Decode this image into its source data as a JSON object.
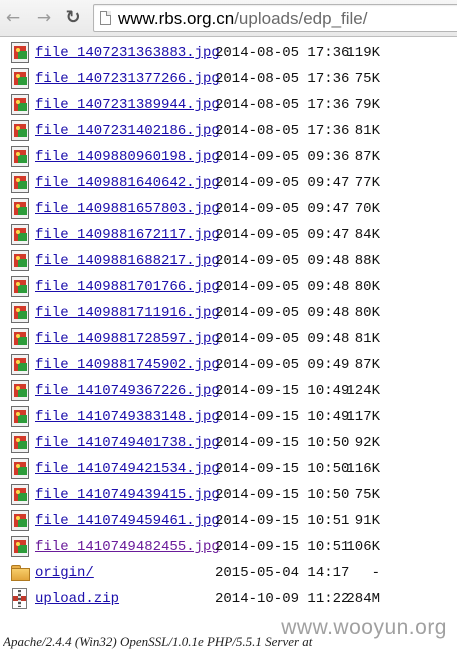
{
  "browser": {
    "url_host": "www.rbs.org.cn",
    "url_path": "/uploads/edp_file/"
  },
  "listing": {
    "entries": [
      {
        "type": "image",
        "name": "file_1407231363883.jpg",
        "date": "2014-08-05 17:36",
        "size": "119K"
      },
      {
        "type": "image",
        "name": "file_1407231377266.jpg",
        "date": "2014-08-05 17:36",
        "size": "75K"
      },
      {
        "type": "image",
        "name": "file_1407231389944.jpg",
        "date": "2014-08-05 17:36",
        "size": "79K"
      },
      {
        "type": "image",
        "name": "file_1407231402186.jpg",
        "date": "2014-08-05 17:36",
        "size": "81K"
      },
      {
        "type": "image",
        "name": "file_1409880960198.jpg",
        "date": "2014-09-05 09:36",
        "size": "87K"
      },
      {
        "type": "image",
        "name": "file_1409881640642.jpg",
        "date": "2014-09-05 09:47",
        "size": "77K"
      },
      {
        "type": "image",
        "name": "file_1409881657803.jpg",
        "date": "2014-09-05 09:47",
        "size": "70K"
      },
      {
        "type": "image",
        "name": "file_1409881672117.jpg",
        "date": "2014-09-05 09:47",
        "size": "84K"
      },
      {
        "type": "image",
        "name": "file_1409881688217.jpg",
        "date": "2014-09-05 09:48",
        "size": "88K"
      },
      {
        "type": "image",
        "name": "file_1409881701766.jpg",
        "date": "2014-09-05 09:48",
        "size": "80K"
      },
      {
        "type": "image",
        "name": "file_1409881711916.jpg",
        "date": "2014-09-05 09:48",
        "size": "80K"
      },
      {
        "type": "image",
        "name": "file_1409881728597.jpg",
        "date": "2014-09-05 09:48",
        "size": "81K"
      },
      {
        "type": "image",
        "name": "file_1409881745902.jpg",
        "date": "2014-09-05 09:49",
        "size": "87K"
      },
      {
        "type": "image",
        "name": "file_1410749367226.jpg",
        "date": "2014-09-15 10:49",
        "size": "124K"
      },
      {
        "type": "image",
        "name": "file_1410749383148.jpg",
        "date": "2014-09-15 10:49",
        "size": "117K"
      },
      {
        "type": "image",
        "name": "file_1410749401738.jpg",
        "date": "2014-09-15 10:50",
        "size": "92K"
      },
      {
        "type": "image",
        "name": "file_1410749421534.jpg",
        "date": "2014-09-15 10:50",
        "size": "116K"
      },
      {
        "type": "image",
        "name": "file_1410749439415.jpg",
        "date": "2014-09-15 10:50",
        "size": "75K"
      },
      {
        "type": "image",
        "name": "file_1410749459461.jpg",
        "date": "2014-09-15 10:51",
        "size": "91K"
      },
      {
        "type": "image",
        "name": "file_1410749482455.jpg",
        "date": "2014-09-15 10:51",
        "size": "106K",
        "visited": true
      },
      {
        "type": "folder",
        "name": "origin/",
        "date": "2015-05-04 14:17",
        "size": "-"
      },
      {
        "type": "zip",
        "name": "upload.zip",
        "date": "2014-10-09 11:22",
        "size": "284M"
      }
    ]
  },
  "footer": {
    "server_signature": "Apache/2.4.4 (Win32) OpenSSL/1.0.1e PHP/5.5.1 Server at"
  },
  "watermark": {
    "text": "www.wooyun.org"
  },
  "icons": {
    "back": "back-arrow-icon",
    "forward": "forward-arrow-icon",
    "reload": "reload-icon",
    "page": "page-icon",
    "image": "image-file-icon",
    "folder": "folder-icon",
    "zip": "zip-archive-icon"
  },
  "colors": {
    "link": "#1a0dab",
    "visited_link": "#6a1b9a"
  }
}
